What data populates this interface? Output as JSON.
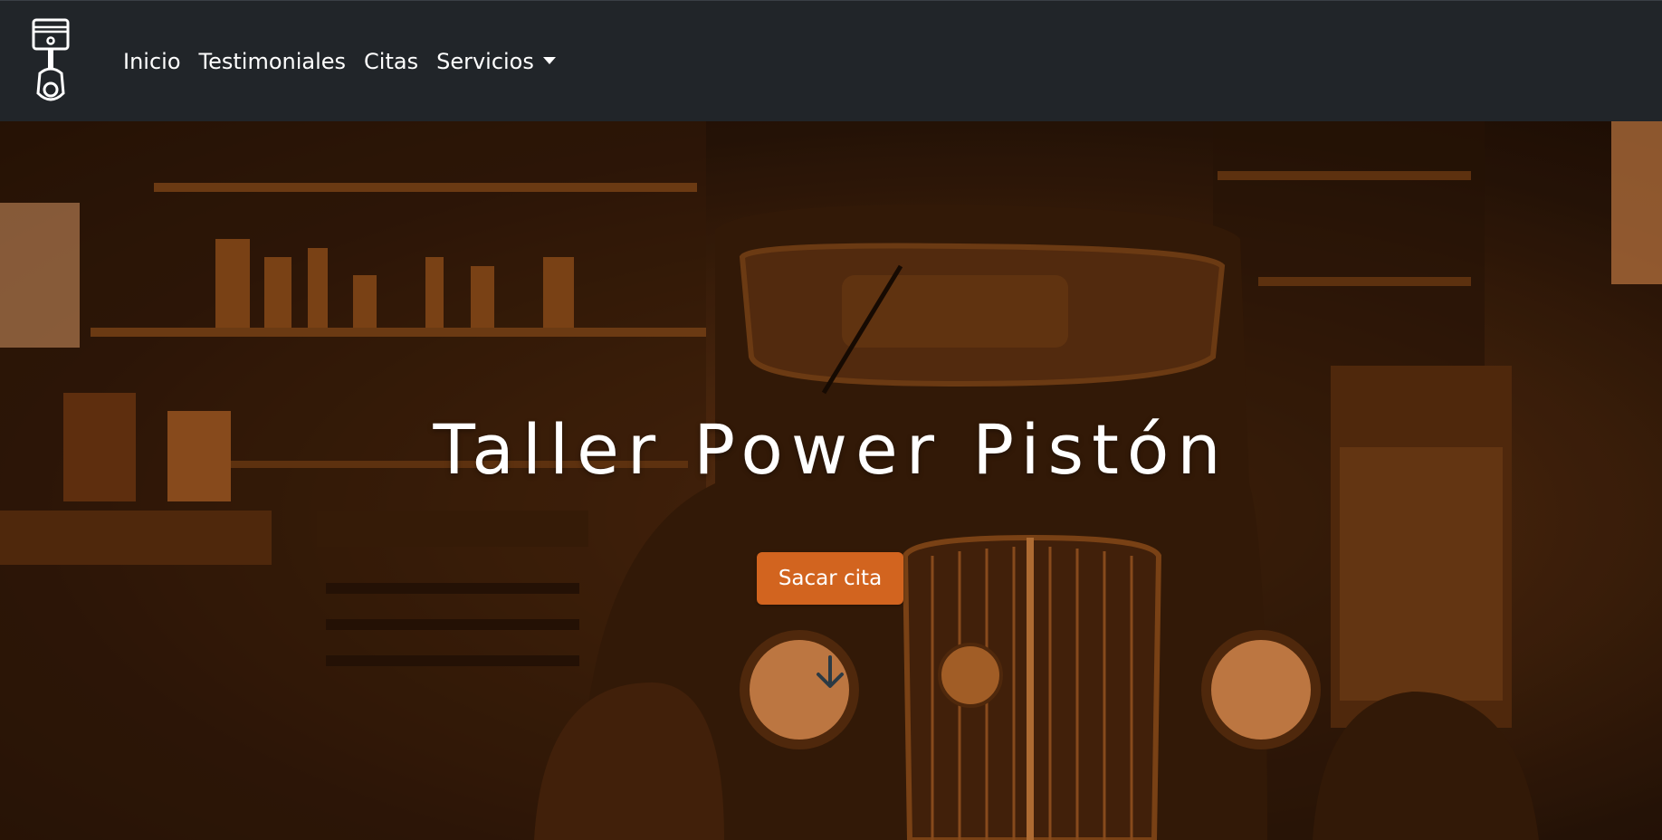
{
  "navbar": {
    "logo_icon": "piston-icon",
    "links": [
      {
        "label": "Inicio"
      },
      {
        "label": "Testimoniales"
      },
      {
        "label": "Citas"
      },
      {
        "label": "Servicios"
      }
    ],
    "background": "#212529"
  },
  "hero": {
    "title": "Taller Power Pistón",
    "cta_label": "Sacar cita",
    "cta_color": "#d2641f",
    "scroll_icon": "arrow-down-icon",
    "background_image": "vintage-car-garage-orange-tint"
  }
}
